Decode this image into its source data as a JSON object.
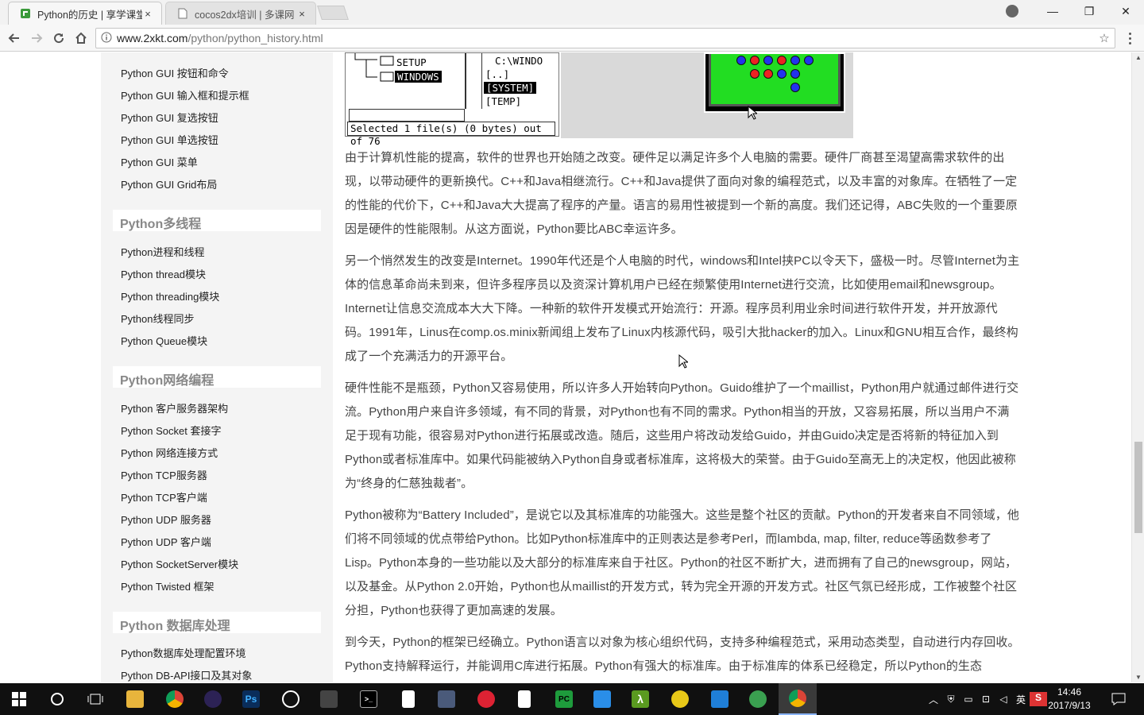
{
  "browser": {
    "tabs": [
      {
        "title": "Python的历史 | 享学课堂",
        "active": true
      },
      {
        "title": "cocos2dx培训 | 多课网",
        "active": false
      }
    ],
    "tab_close_glyph": "×",
    "url_host": "www.2xkt.com",
    "url_path": "/python/python_history.html",
    "window_controls": {
      "minimize": "—",
      "maximize": "❐",
      "close": "✕"
    }
  },
  "sidebar": {
    "items_top": [
      "Python GUI 按钮和命令",
      "Python GUI 输入框和提示框",
      "Python GUI 复选按钮",
      "Python GUI 单选按钮",
      "Python GUI 菜单",
      "Python GUI Grid布局"
    ],
    "sections": [
      {
        "title": "Python多线程",
        "items": [
          "Python进程和线程",
          "Python thread模块",
          "Python threading模块",
          "Python线程同步",
          "Python Queue模块"
        ]
      },
      {
        "title": "Python网络编程",
        "items": [
          "Python 客户服务器架构",
          "Python Socket 套接字",
          "Python 网络连接方式",
          "Python TCP服务器",
          "Python TCP客户端",
          "Python UDP 服务器",
          "Python UDP 客户端",
          "Python SocketServer模块",
          "Python Twisted 框架"
        ]
      },
      {
        "title": "Python 数据库处理",
        "items": [
          "Python数据库处理配置环境",
          "Python DB-API接口及其对象"
        ]
      }
    ]
  },
  "figure": {
    "folders": [
      "SETUP",
      "WINDOWS"
    ],
    "right_pane": [
      "C:\\WINDO",
      "[..]",
      "[SYSTEM]",
      "[TEMP]"
    ],
    "status": "Selected 1 file(s) (0 bytes) out of 76"
  },
  "article": {
    "paragraphs": [
      "由于计算机性能的提高，软件的世界也开始随之改变。硬件足以满足许多个人电脑的需要。硬件厂商甚至渴望高需求软件的出现，以带动硬件的更新换代。C++和Java相继流行。C++和Java提供了面向对象的编程范式，以及丰富的对象库。在牺牲了一定的性能的代价下，C++和Java大大提高了程序的产量。语言的易用性被提到一个新的高度。我们还记得，ABC失败的一个重要原因是硬件的性能限制。从这方面说，Python要比ABC幸运许多。",
      "另一个悄然发生的改变是Internet。1990年代还是个人电脑的时代，windows和Intel挟PC以令天下，盛极一时。尽管Internet为主体的信息革命尚未到来，但许多程序员以及资深计算机用户已经在频繁使用Internet进行交流，比如使用email和newsgroup。Internet让信息交流成本大大下降。一种新的软件开发模式开始流行：开源。程序员利用业余时间进行软件开发，并开放源代码。1991年，Linus在comp.os.minix新闻组上发布了Linux内核源代码，吸引大批hacker的加入。Linux和GNU相互合作，最终构成了一个充满活力的开源平台。",
      "硬件性能不是瓶颈，Python又容易使用，所以许多人开始转向Python。Guido维护了一个maillist，Python用户就通过邮件进行交流。Python用户来自许多领域，有不同的背景，对Python也有不同的需求。Python相当的开放，又容易拓展，所以当用户不满足于现有功能，很容易对Python进行拓展或改造。随后，这些用户将改动发给Guido，并由Guido决定是否将新的特征加入到Python或者标准库中。如果代码能被纳入Python自身或者标准库，这将极大的荣誉。由于Guido至高无上的决定权，他因此被称为“终身的仁慈独裁者”。",
      "Python被称为“Battery Included”，是说它以及其标准库的功能强大。这些是整个社区的贡献。Python的开发者来自不同领域，他们将不同领域的优点带给Python。比如Python标准库中的正则表达是参考Perl，而lambda, map, filter, reduce等函数参考了Lisp。Python本身的一些功能以及大部分的标准库来自于社区。Python的社区不断扩大，进而拥有了自己的newsgroup，网站，以及基金。从Python 2.0开始，Python也从maillist的开发方式，转为完全开源的开发方式。社区气氛已经形成，工作被整个社区分担，Python也获得了更加高速的发展。",
      "到今天，Python的框架已经确立。Python语言以对象为核心组织代码，支持多种编程范式，采用动态类型，自动进行内存回收。Python支持解释运行，并能调用C库进行拓展。Python有强大的标准库。由于标准库的体系已经稳定，所以Python的生态"
    ]
  },
  "taskbar": {
    "apps": [
      "start",
      "search",
      "task-view",
      "file-explorer",
      "chrome",
      "eclipse",
      "photoshop",
      "qq",
      "app-tool",
      "cmd",
      "file",
      "app-grid",
      "app-snail",
      "file-2",
      "pycharm",
      "photo-viewer",
      "lambda-app",
      "app-round",
      "app-blue",
      "app-green",
      "chrome-active"
    ],
    "tray_ime": "英",
    "clock_time": "14:46",
    "clock_date": "2017/9/13"
  },
  "colors": {
    "accent_green": "#22dd22",
    "sidebar_bg": "#f4f4f4",
    "text": "#444444"
  }
}
